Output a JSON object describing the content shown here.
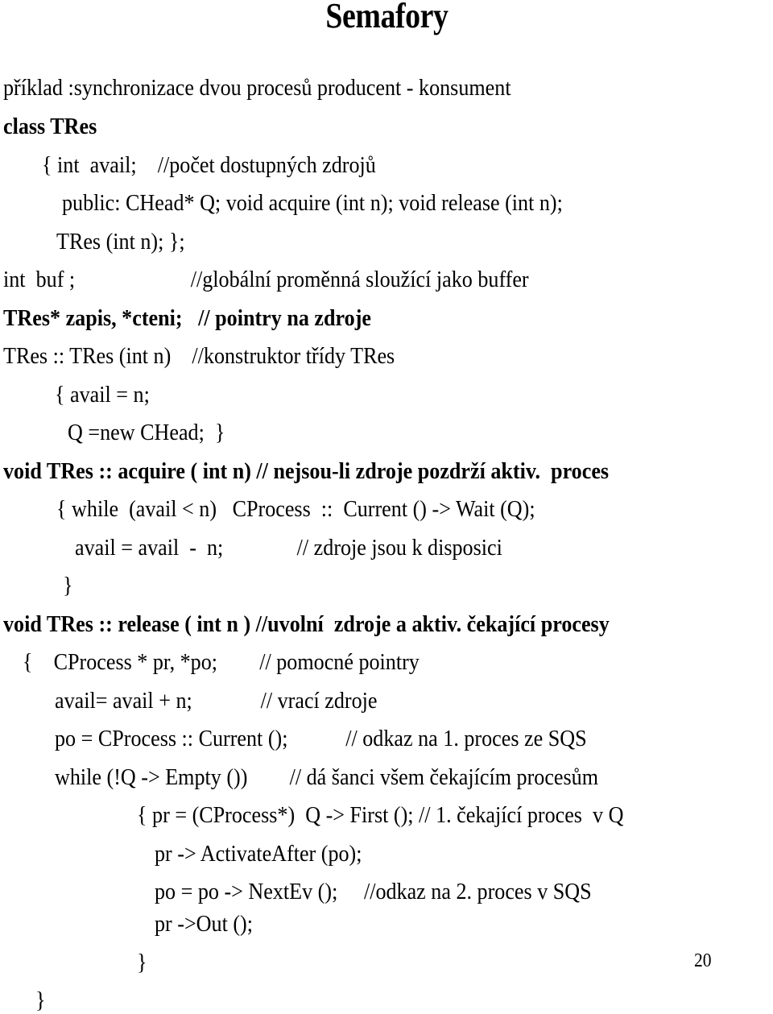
{
  "slide": {
    "title": "Semafory",
    "page_number": "20",
    "lines": [
      {
        "text": "příklad :synchronizace dvou procesů producent - konsument",
        "bold": false
      },
      {
        "text": "class TRes",
        "bold": true
      },
      {
        "text": "{ int  avail;    //počet dostupných zdrojů",
        "bold": false
      },
      {
        "text": "public: CHead* Q; void acquire (int n); void release (int n);",
        "bold": false
      },
      {
        "text": "TRes (int n); };",
        "bold": false
      },
      {
        "text": "int  buf ;                      //globální proměnná sloužící jako buffer",
        "bold": false
      },
      {
        "text": "TRes* zapis, *cteni;   // pointry na zdroje",
        "bold": true
      },
      {
        "text": "TRes :: TRes (int n)    //konstruktor třídy TRes",
        "bold": false
      },
      {
        "text": "{ avail = n;",
        "bold": false
      },
      {
        "text": "Q =new CHead;  }",
        "bold": false
      },
      {
        "text": "void TRes :: acquire ( int n) // nejsou-li zdroje pozdrží aktiv.  proces",
        "bold": true
      },
      {
        "text": "{ while  (avail < n)   CProcess  ::  Current () -> Wait (Q);",
        "bold": false
      },
      {
        "text": "avail = avail  -  n;              // zdroje jsou k disposici",
        "bold": false
      },
      {
        "text": "}",
        "bold": false
      },
      {
        "text": "void TRes :: release ( int n ) //uvolní  zdroje a aktiv. čekající procesy",
        "bold": true
      },
      {
        "text": "{    CProcess * pr, *po;        // pomocné pointry",
        "bold": false
      },
      {
        "text": "avail= avail + n;             // vrací zdroje",
        "bold": false
      },
      {
        "text": "po = CProcess :: Current ();           // odkaz na 1. proces ze SQS",
        "bold": false
      },
      {
        "text": "while (!Q -> Empty ())        // dá šanci všem čekajícím procesům",
        "bold": false
      },
      {
        "text": "{ pr = (CProcess*)  Q -> First (); // 1. čekající proces  v Q",
        "bold": false
      },
      {
        "text": "pr -> ActivateAfter (po);",
        "bold": false
      },
      {
        "text": "po = po -> NextEv ();     //odkaz na 2. proces v SQS",
        "bold": false
      },
      {
        "text": "pr ->Out ();",
        "bold": false
      },
      {
        "text": "}",
        "bold": false
      },
      {
        "text": "}",
        "bold": false
      }
    ]
  }
}
